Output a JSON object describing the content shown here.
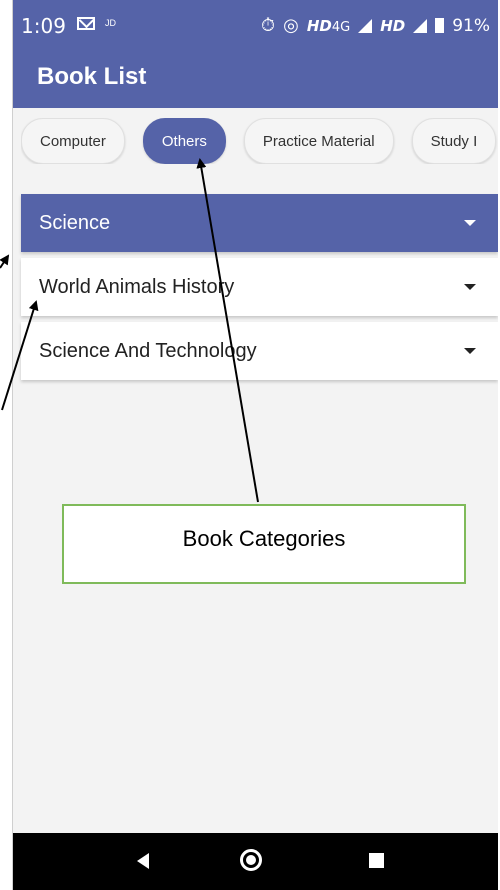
{
  "status_bar": {
    "time": "1:09",
    "jio_label": "JD",
    "network_label_1": "HD",
    "network_label_2": "4G",
    "network_label_3": "HD",
    "battery": "91%"
  },
  "app_bar": {
    "title": "Book List"
  },
  "categories": [
    {
      "label": "Computer",
      "active": false
    },
    {
      "label": "Others",
      "active": true
    },
    {
      "label": "Practice Material",
      "active": false
    },
    {
      "label": "Study I",
      "active": false
    }
  ],
  "panels": [
    {
      "label": "Science",
      "expanded": true
    },
    {
      "label": "World Animals History",
      "expanded": false
    },
    {
      "label": "Science And Technology",
      "expanded": false
    }
  ],
  "annotation": {
    "text": "Book Categories"
  },
  "colors": {
    "primary": "#5563a8",
    "callout_border": "#7fba5a"
  }
}
